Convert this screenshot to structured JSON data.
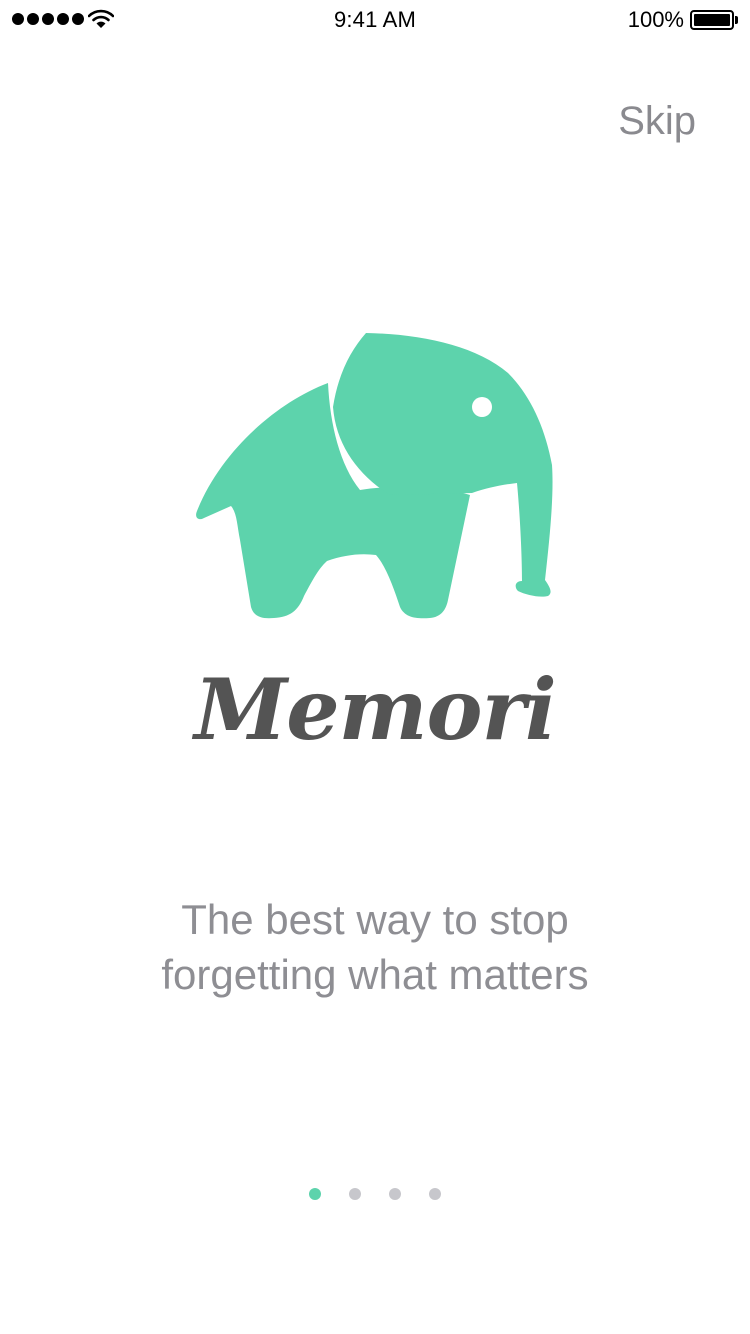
{
  "status_bar": {
    "signal_icon": "signal-dots-icon",
    "wifi_icon": "wifi-icon",
    "time": "9:41 AM",
    "battery_percent": "100%",
    "battery_icon": "battery-icon"
  },
  "skip_label": "Skip",
  "logo": {
    "icon": "elephant-icon",
    "wordmark": "Memori",
    "color": "#5dd3ac",
    "wordmark_color": "#545454"
  },
  "tagline": {
    "line1": "The best way to stop",
    "line2": "forgetting what matters"
  },
  "pagination": {
    "total_pages": 4,
    "current_page": 1,
    "active_color": "#5dd3ac",
    "inactive_color": "#c7c7cc"
  }
}
